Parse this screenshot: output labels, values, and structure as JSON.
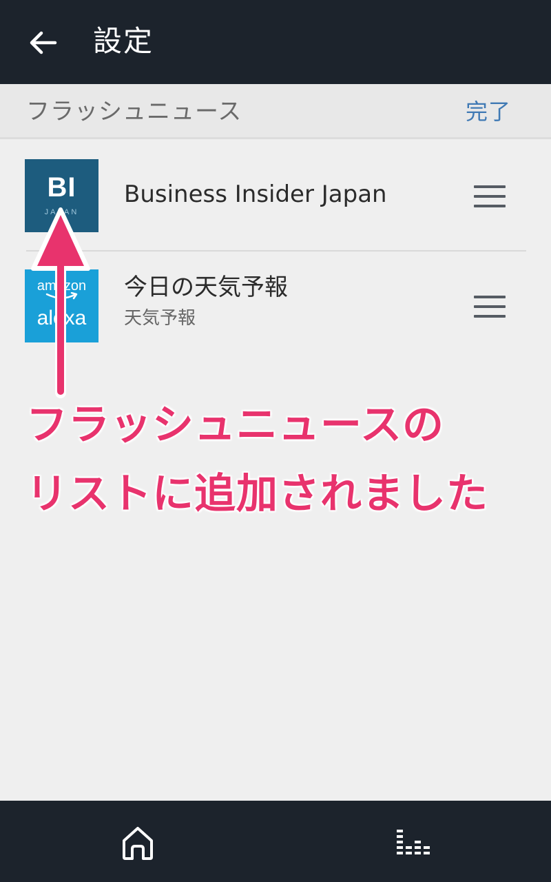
{
  "header": {
    "title": "設定",
    "back_icon": "arrow-left-icon"
  },
  "section": {
    "title": "フラッシュニュース",
    "done_label": "完了"
  },
  "list": {
    "items": [
      {
        "title": "Business Insider Japan",
        "subtitle": "",
        "thumb": {
          "main": "BI",
          "sub": "JAPAN",
          "color": "#1d5c7e"
        }
      },
      {
        "title": "今日の天気予報",
        "subtitle": "天気予報",
        "thumb": {
          "top": "amazon",
          "bottom": "alexa",
          "color": "#1aa0d8"
        }
      }
    ]
  },
  "annotation": {
    "line1": "フラッシュニュースの",
    "line2": "リストに追加されました",
    "color": "#e8336d"
  },
  "bottom_nav": {
    "items": [
      "home-icon",
      "equalizer-icon"
    ]
  },
  "colors": {
    "bar": "#1c232c",
    "accent": "#3f79b4",
    "background": "#efefef"
  }
}
